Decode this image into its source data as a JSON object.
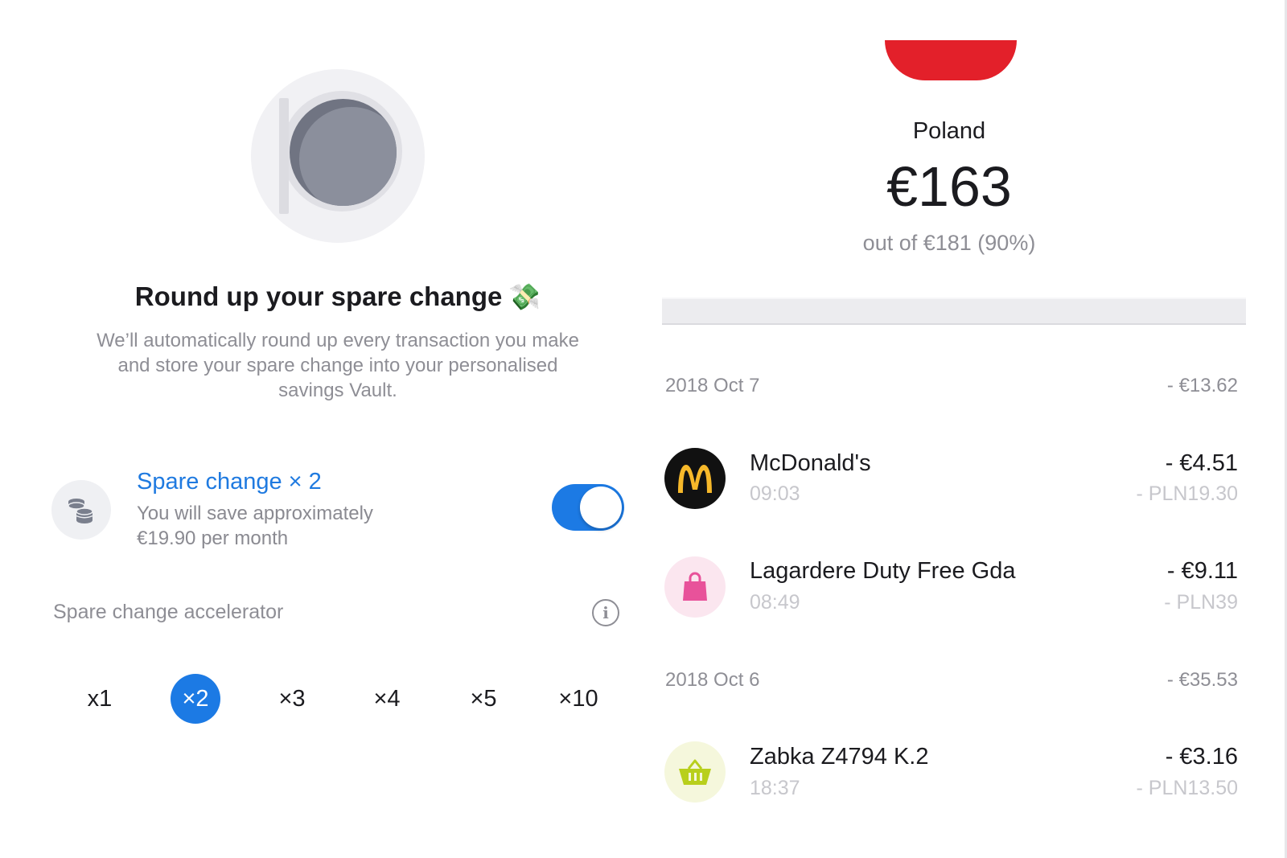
{
  "left": {
    "promo": {
      "title": "Round up your spare change",
      "title_emoji": "💸",
      "description": "We’ll automatically round up every transaction you make and store your spare change into your personalised savings Vault."
    },
    "spare_change": {
      "title": "Spare change × 2",
      "subtitle_line1": "You will save approximately",
      "subtitle_line2": "€19.90 per month",
      "toggle_on": true
    },
    "accelerator": {
      "label": "Spare change accelerator",
      "options": [
        "x1",
        "×2",
        "×3",
        "×4",
        "×5",
        "×10"
      ],
      "selected": "×2"
    }
  },
  "right": {
    "country": "Poland",
    "amount": "€163",
    "out_of": "out of €181 (90%)",
    "groups": [
      {
        "date": "2018 Oct 7",
        "total": "- €13.62",
        "transactions": [
          {
            "name": "McDonald's",
            "time": "09:03",
            "amount": "- €4.51",
            "local": "- PLN19.30",
            "icon": "mcdonalds-logo-icon"
          },
          {
            "name": "Lagardere Duty Free Gda",
            "time": "08:49",
            "amount": "- €9.11",
            "local": "- PLN39",
            "icon": "shopping-bag-icon"
          }
        ]
      },
      {
        "date": "2018 Oct 6",
        "total": "- €35.53",
        "transactions": [
          {
            "name": "Zabka Z4794 K.2",
            "time": "18:37",
            "amount": "- €3.16",
            "local": "- PLN13.50",
            "icon": "shopping-basket-icon"
          }
        ]
      }
    ]
  },
  "colors": {
    "accent": "#1c7ae4",
    "flag_red": "#e3202a",
    "mcdonalds_bg": "#111111",
    "mcdonalds_arches": "#f6b82a",
    "bag_pink": "#e8529a",
    "basket_green": "#b8cf1c"
  }
}
